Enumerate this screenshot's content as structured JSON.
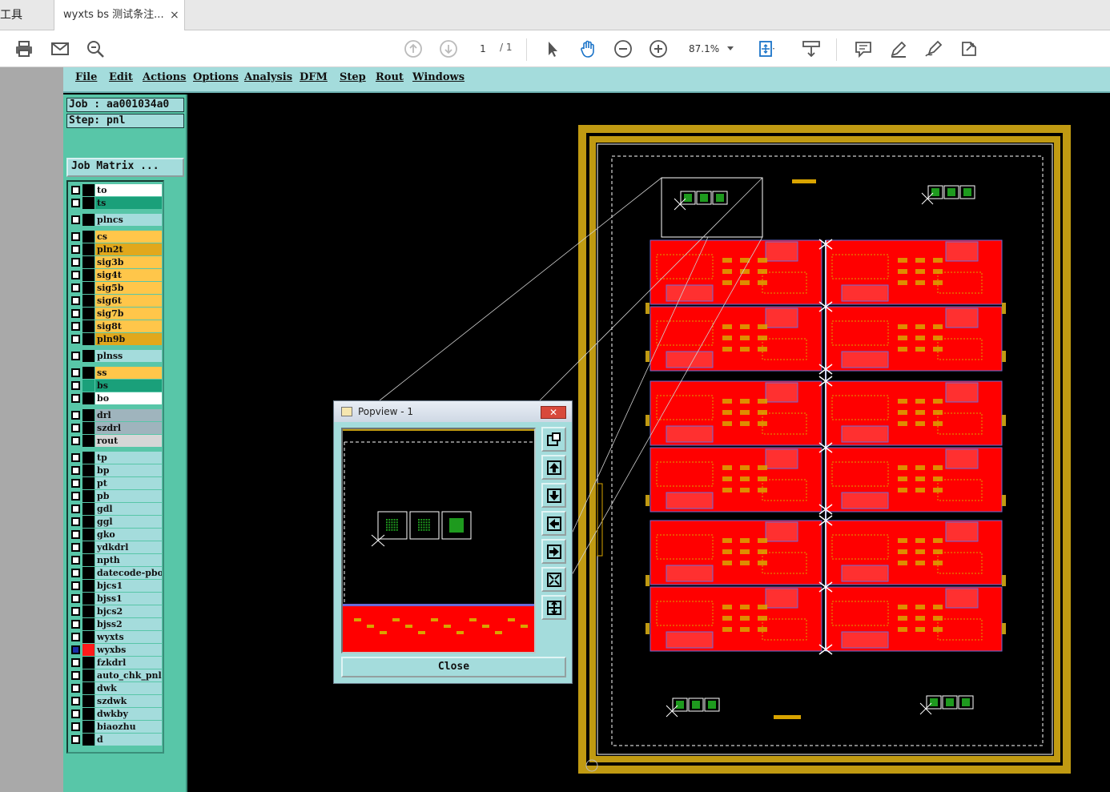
{
  "viewer": {
    "tools_tab": "工具",
    "doc_tab": "wyxts bs  测试条注...",
    "close_tab": "×",
    "page_current": "1",
    "page_total": "/ 1",
    "zoom": "87.1%"
  },
  "cam": {
    "menu": [
      "File",
      "Edit",
      "Actions",
      "Options",
      "Analysis",
      "DFM",
      "Step",
      "Rout",
      "Windows"
    ],
    "job": "Job : aa001034a0",
    "step": "Step: pnl",
    "job_matrix": "Job Matrix ...",
    "layers": [
      {
        "name": "to",
        "color": "#ffffff"
      },
      {
        "name": "ts",
        "color": "#1aa07a"
      },
      {
        "name": "plncs",
        "color": "#a4dcdc"
      },
      {
        "name": "cs",
        "color": "#ffc64a"
      },
      {
        "name": "pln2t",
        "color": "#e1a81c"
      },
      {
        "name": "sig3b",
        "color": "#ffc64a"
      },
      {
        "name": "sig4t",
        "color": "#ffc64a"
      },
      {
        "name": "sig5b",
        "color": "#ffc64a"
      },
      {
        "name": "sig6t",
        "color": "#ffc64a"
      },
      {
        "name": "sig7b",
        "color": "#ffc64a"
      },
      {
        "name": "sig8t",
        "color": "#ffc64a"
      },
      {
        "name": "pln9b",
        "color": "#e1a81c"
      },
      {
        "name": "plnss",
        "color": "#a4dcdc"
      },
      {
        "name": "ss",
        "color": "#ffc64a"
      },
      {
        "name": "bs",
        "color": "#1aa07a"
      },
      {
        "name": "bo",
        "color": "#ffffff"
      },
      {
        "name": "drl",
        "color": "#9fb4bd"
      },
      {
        "name": "szdrl",
        "color": "#9fb4bd"
      },
      {
        "name": "rout",
        "color": "#d6d6d6"
      },
      {
        "name": "tp",
        "color": "#a4dcdc"
      },
      {
        "name": "bp",
        "color": "#a4dcdc"
      },
      {
        "name": "pt",
        "color": "#a4dcdc"
      },
      {
        "name": "pb",
        "color": "#a4dcdc"
      },
      {
        "name": "gdl",
        "color": "#a4dcdc"
      },
      {
        "name": "ggl",
        "color": "#a4dcdc"
      },
      {
        "name": "gko",
        "color": "#a4dcdc"
      },
      {
        "name": "ydkdrl",
        "color": "#a4dcdc"
      },
      {
        "name": "npth",
        "color": "#a4dcdc"
      },
      {
        "name": "datecode-pbo",
        "color": "#a4dcdc"
      },
      {
        "name": "bjcs1",
        "color": "#a4dcdc"
      },
      {
        "name": "bjss1",
        "color": "#a4dcdc"
      },
      {
        "name": "bjcs2",
        "color": "#a4dcdc"
      },
      {
        "name": "bjss2",
        "color": "#a4dcdc"
      },
      {
        "name": "wyxts",
        "color": "#a4dcdc"
      },
      {
        "name": "wyxbs",
        "color": "#a4dcdc"
      },
      {
        "name": "fzkdrl",
        "color": "#a4dcdc"
      },
      {
        "name": "auto_chk_pnl",
        "color": "#a4dcdc"
      },
      {
        "name": "dwk",
        "color": "#a4dcdc"
      },
      {
        "name": "szdwk",
        "color": "#a4dcdc"
      },
      {
        "name": "dwkby",
        "color": "#a4dcdc"
      },
      {
        "name": "biaozhu",
        "color": "#a4dcdc"
      },
      {
        "name": "d",
        "color": "#a4dcdc"
      }
    ]
  },
  "popview": {
    "title": "Popview - 1",
    "close_label": "Close"
  },
  "colors": {
    "board_red": "#ff0000",
    "frame_gold": "#c09a12",
    "pad_green": "#1e9a1e",
    "cam_bg": "#a4dcdc",
    "panel_green": "#58c6a8"
  }
}
